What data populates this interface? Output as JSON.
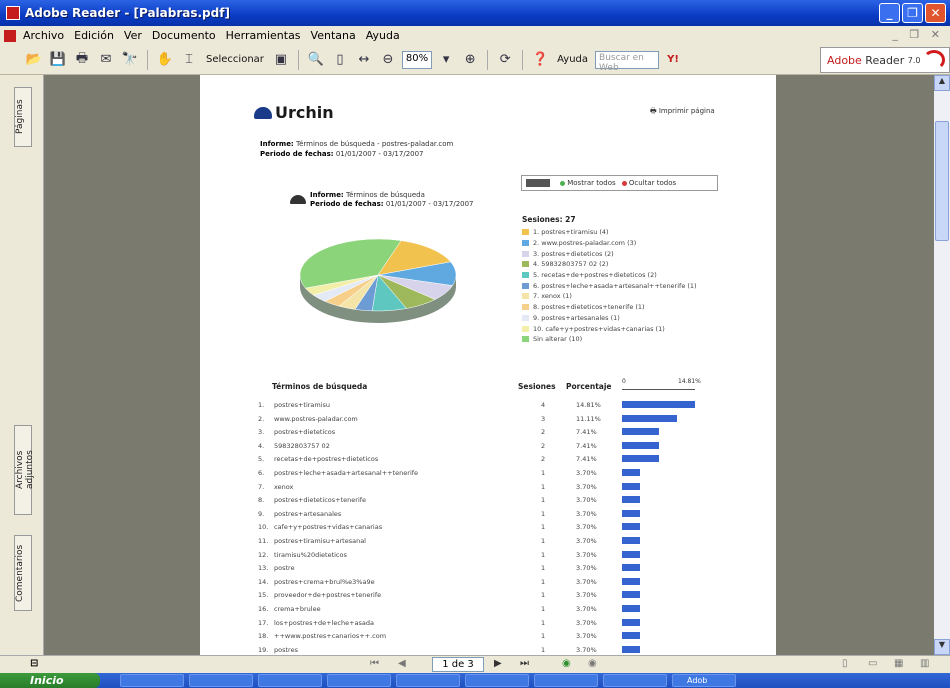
{
  "window": {
    "title": "Adobe Reader - [Palabras.pdf]"
  },
  "menu": [
    "Archivo",
    "Edición",
    "Ver",
    "Documento",
    "Herramientas",
    "Ventana",
    "Ayuda"
  ],
  "toolbar": {
    "select_label": "Seleccionar",
    "zoom": "80%",
    "help_label": "Ayuda",
    "search_placeholder": "Buscar en Web"
  },
  "brand": {
    "name": "Adobe",
    "product": "Reader",
    "version": "7.0"
  },
  "side_tabs": [
    "Páginas",
    "Archivos adjuntos",
    "Comentarios"
  ],
  "report": {
    "logo": "Urchin",
    "print_label": "Imprimir página",
    "info_label": "Informe:",
    "info_value": "Términos de búsqueda - postres-paladar.com",
    "period_label": "Periodo de fechas:",
    "period_value": "01/01/2007 - 03/17/2007",
    "chart_info_value": "Términos de búsqueda",
    "chart_period_value": "01/01/2007 - 03/17/2007",
    "show_all": "Mostrar todos",
    "hide_all": "Ocultar todos",
    "sessions_label": "Sesiones: 27",
    "col_terms": "Términos de búsqueda",
    "col_sessions": "Sesiones",
    "col_percent": "Porcentaje",
    "scale_min": "0",
    "scale_max": "14.81%"
  },
  "chart_data": {
    "type": "pie",
    "legend": [
      "1. postres+tiramisu (4)",
      "2. www.postres-paladar.com (3)",
      "3. postres+dieteticos (2)",
      "4. 59832803757 02 (2)",
      "5. recetas+de+postres+dieteticos (2)",
      "6. postres+leche+asada+artesanal++tenerife (1)",
      "7. xenox (1)",
      "8. postres+dieteticos+tenerife (1)",
      "9. postres+artesanales (1)",
      "10. cafe+y+postres+vidas+canarias (1)",
      "Sin alterar (10)"
    ],
    "values": [
      4,
      3,
      2,
      2,
      2,
      1,
      1,
      1,
      1,
      1,
      10
    ],
    "colors": [
      "#f2c24e",
      "#5fa9e0",
      "#d6d3ea",
      "#9eb85c",
      "#5ec7c0",
      "#6d9bd4",
      "#f4e4a8",
      "#f6d08a",
      "#e3e9f5",
      "#f3eea8",
      "#8cd47a"
    ]
  },
  "table": [
    {
      "n": "1.",
      "term": "postres+tiramisu",
      "s": "4",
      "p": "14.81%",
      "v": 14.81
    },
    {
      "n": "2.",
      "term": "www.postres-paladar.com",
      "s": "3",
      "p": "11.11%",
      "v": 11.11
    },
    {
      "n": "3.",
      "term": "postres+dieteticos",
      "s": "2",
      "p": "7.41%",
      "v": 7.41
    },
    {
      "n": "4.",
      "term": "59832803757 02",
      "s": "2",
      "p": "7.41%",
      "v": 7.41
    },
    {
      "n": "5.",
      "term": "recetas+de+postres+dieteticos",
      "s": "2",
      "p": "7.41%",
      "v": 7.41
    },
    {
      "n": "6.",
      "term": "postres+leche+asada+artesanal++tenerife",
      "s": "1",
      "p": "3.70%",
      "v": 3.7
    },
    {
      "n": "7.",
      "term": "xenox",
      "s": "1",
      "p": "3.70%",
      "v": 3.7
    },
    {
      "n": "8.",
      "term": "postres+dieteticos+tenerife",
      "s": "1",
      "p": "3.70%",
      "v": 3.7
    },
    {
      "n": "9.",
      "term": "postres+artesanales",
      "s": "1",
      "p": "3.70%",
      "v": 3.7
    },
    {
      "n": "10.",
      "term": "cafe+y+postres+vidas+canarias",
      "s": "1",
      "p": "3.70%",
      "v": 3.7
    },
    {
      "n": "11.",
      "term": "postres+tiramisu+artesanal",
      "s": "1",
      "p": "3.70%",
      "v": 3.7
    },
    {
      "n": "12.",
      "term": "tiramisu%20dieteticos",
      "s": "1",
      "p": "3.70%",
      "v": 3.7
    },
    {
      "n": "13.",
      "term": "postre",
      "s": "1",
      "p": "3.70%",
      "v": 3.7
    },
    {
      "n": "14.",
      "term": "postres+crema+brul%e3%a9e",
      "s": "1",
      "p": "3.70%",
      "v": 3.7
    },
    {
      "n": "15.",
      "term": "proveedor+de+postres+tenerife",
      "s": "1",
      "p": "3.70%",
      "v": 3.7
    },
    {
      "n": "16.",
      "term": "crema+brulee",
      "s": "1",
      "p": "3.70%",
      "v": 3.7
    },
    {
      "n": "17.",
      "term": "los+postres+de+leche+asada",
      "s": "1",
      "p": "3.70%",
      "v": 3.7
    },
    {
      "n": "18.",
      "term": "++www.postres+canarios++.com",
      "s": "1",
      "p": "3.70%",
      "v": 3.7
    },
    {
      "n": "19.",
      "term": "postres",
      "s": "1",
      "p": "3.70%",
      "v": 3.7
    }
  ],
  "status": {
    "page_indicator": "1 de 3"
  },
  "taskbar": {
    "start": "Inicio",
    "tasks": [
      "",
      "",
      "",
      "",
      "",
      "",
      "",
      "",
      "Adob"
    ]
  }
}
